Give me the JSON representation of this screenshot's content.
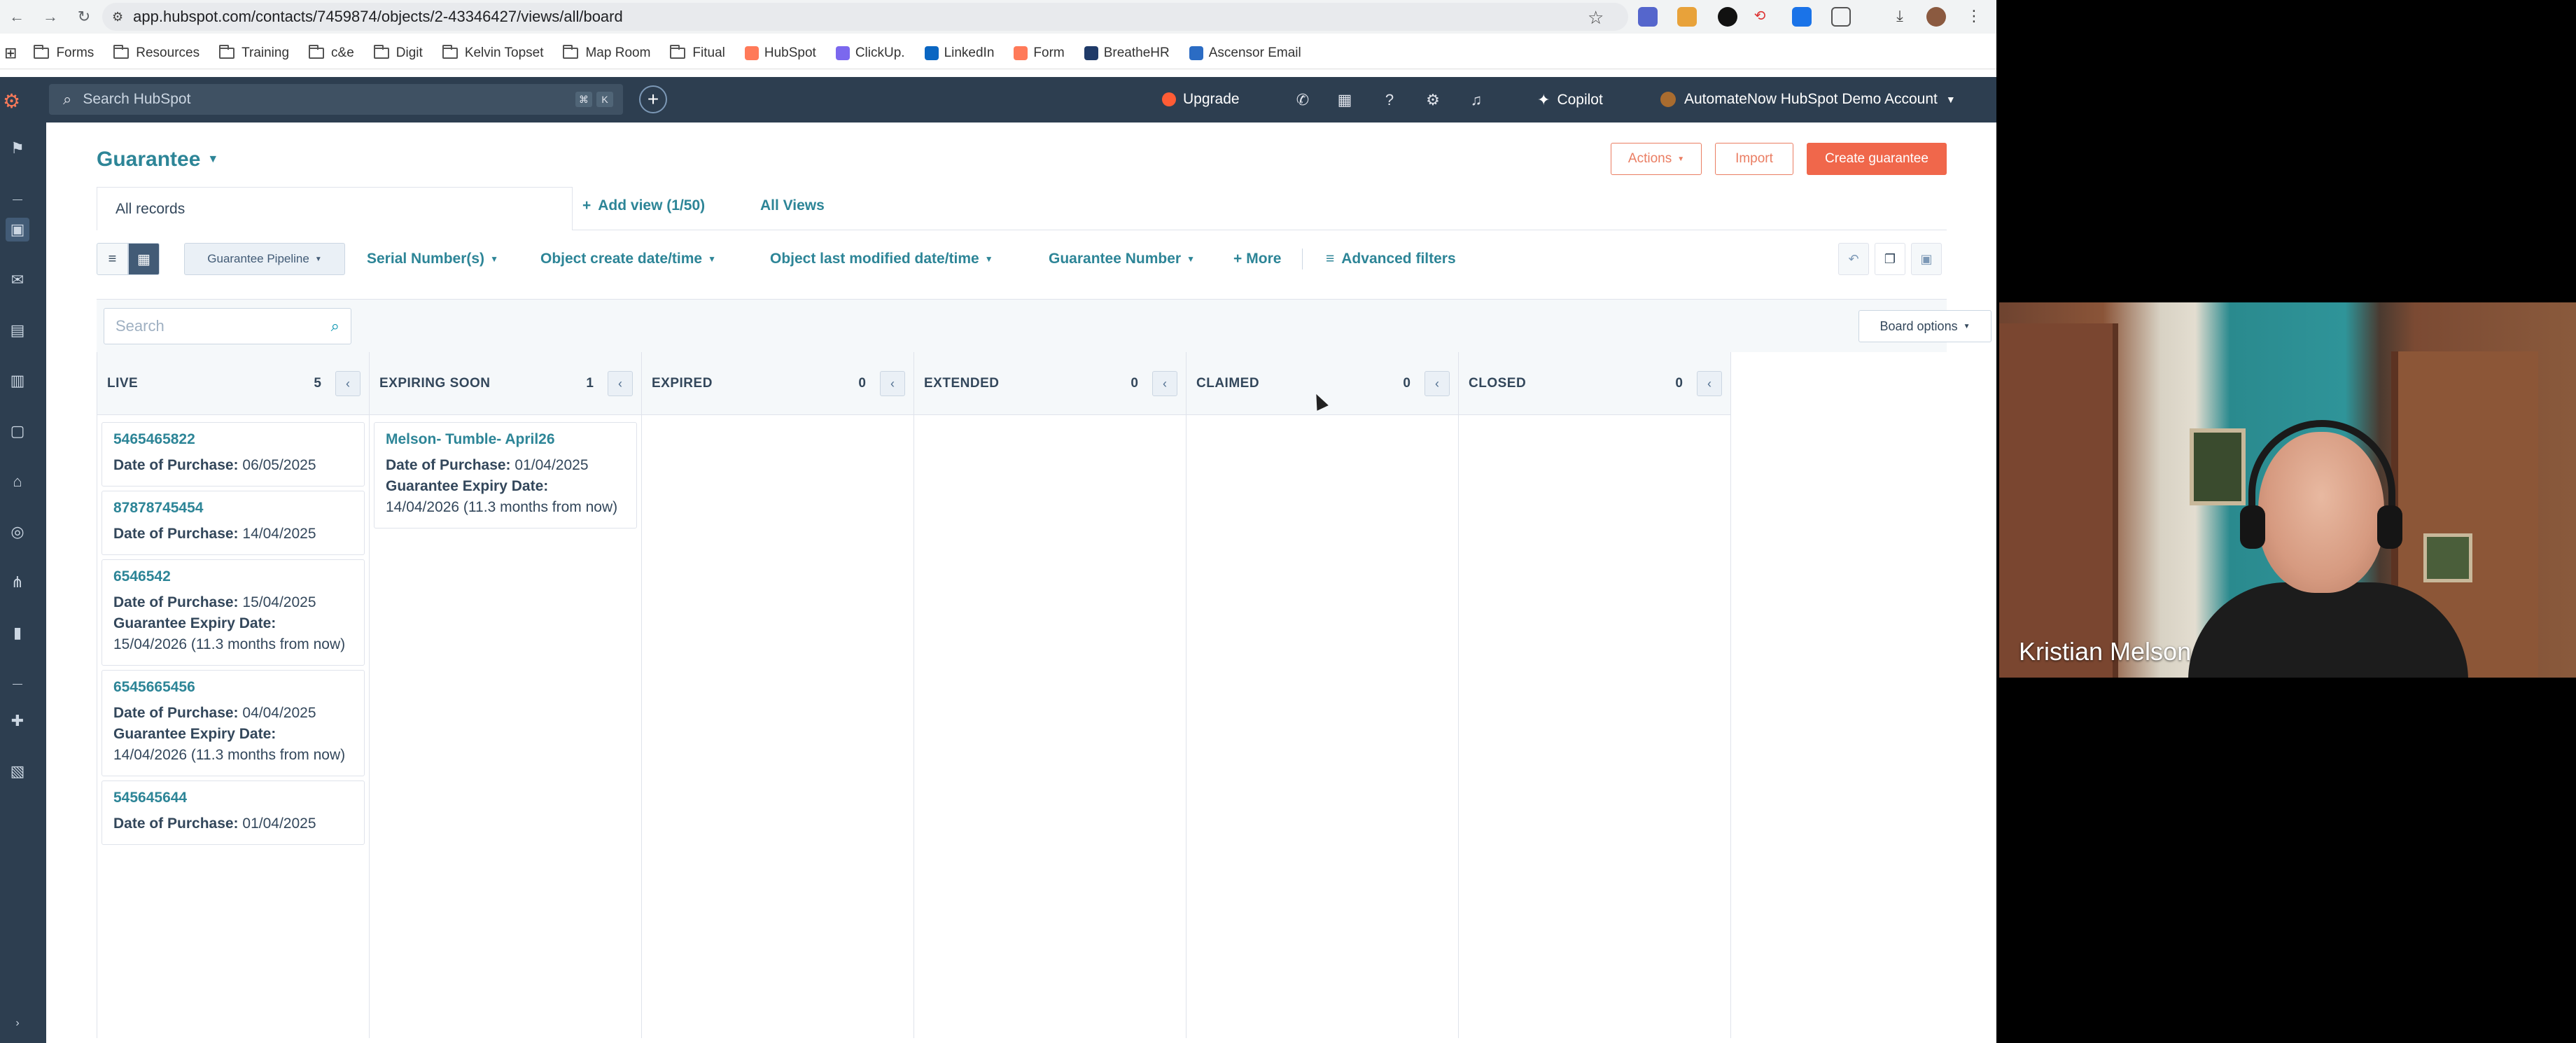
{
  "browser": {
    "url": "app.hubspot.com/contacts/7459874/objects/2-43346427/views/all/board",
    "bookmarks": [
      "Forms",
      "Resources",
      "Training",
      "c&e",
      "Digit",
      "Kelvin Topset",
      "Map Room",
      "Fitual",
      "HubSpot",
      "ClickUp.",
      "LinkedIn",
      "Form",
      "BreatheHR",
      "Ascensor Email"
    ]
  },
  "topnav": {
    "search_placeholder": "Search HubSpot",
    "kbd1": "⌘",
    "kbd2": "K",
    "upgrade": "Upgrade",
    "copilot": "Copilot",
    "account": "AutomateNow HubSpot Demo Account"
  },
  "header": {
    "title": "Guarantee",
    "actions": "Actions",
    "import": "Import",
    "create": "Create guarantee"
  },
  "tabs": {
    "all_records": "All records",
    "add_view": "Add view (1/50)",
    "all_views": "All Views"
  },
  "filters": {
    "pipeline": "Guarantee Pipeline",
    "items": [
      "Serial Number(s)",
      "Object create date/time",
      "Object last modified date/time",
      "Guarantee Number"
    ],
    "more": "More",
    "advanced": "Advanced filters"
  },
  "board": {
    "search_placeholder": "Search",
    "options": "Board options",
    "columns": [
      {
        "name": "LIVE",
        "count": "5",
        "cards": [
          {
            "title": "5465465822",
            "lines": [
              {
                "k": "Date of Purchase:",
                "v": "06/05/2025"
              }
            ]
          },
          {
            "title": "87878745454",
            "lines": [
              {
                "k": "Date of Purchase:",
                "v": "14/04/2025"
              }
            ]
          },
          {
            "title": "6546542",
            "lines": [
              {
                "k": "Date of Purchase:",
                "v": "15/04/2025"
              },
              {
                "k": "Guarantee Expiry Date:",
                "v": "15/04/2026 (11.3 months from now)"
              }
            ]
          },
          {
            "title": "6545665456",
            "lines": [
              {
                "k": "Date of Purchase:",
                "v": "04/04/2025"
              },
              {
                "k": "Guarantee Expiry Date:",
                "v": "14/04/2026 (11.3 months from now)"
              }
            ]
          },
          {
            "title": "545645644",
            "lines": [
              {
                "k": "Date of Purchase:",
                "v": "01/04/2025"
              }
            ]
          }
        ]
      },
      {
        "name": "EXPIRING SOON",
        "count": "1",
        "cards": [
          {
            "title": "Melson- Tumble- April26",
            "lines": [
              {
                "k": "Date of Purchase:",
                "v": "01/04/2025"
              },
              {
                "k": "Guarantee Expiry Date:",
                "v": "14/04/2026 (11.3 months from now)"
              }
            ]
          }
        ]
      },
      {
        "name": "EXPIRED",
        "count": "0",
        "cards": []
      },
      {
        "name": "EXTENDED",
        "count": "0",
        "cards": []
      },
      {
        "name": "CLAIMED",
        "count": "0",
        "cards": []
      },
      {
        "name": "CLOSED",
        "count": "0",
        "cards": []
      }
    ]
  },
  "webcam": {
    "name": "Kristian Melson"
  }
}
